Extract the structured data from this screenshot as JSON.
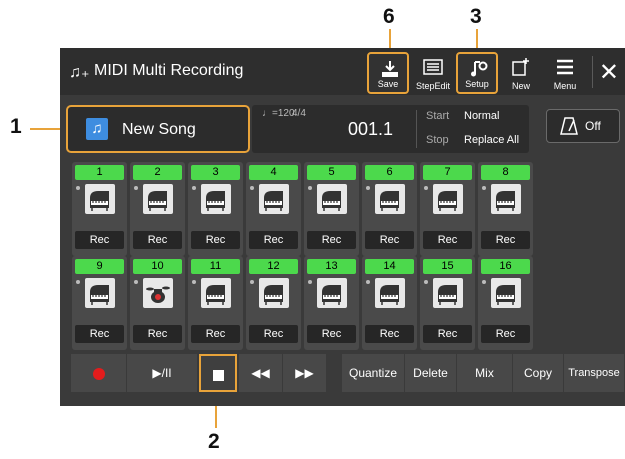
{
  "callouts": {
    "c1": "1",
    "c2": "2",
    "c3": "3",
    "c6": "6"
  },
  "window": {
    "title": "MIDI Multi Recording"
  },
  "toolbar": {
    "save": "Save",
    "stepedit": "StepEdit",
    "setup": "Setup",
    "new": "New",
    "menu": "Menu"
  },
  "song": {
    "name": "New Song",
    "tempo": "♩=120",
    "meter": "4/4",
    "position": "001.1",
    "start_label": "Start",
    "start_value": "Normal",
    "stop_label": "Stop",
    "stop_value": "Replace All"
  },
  "metronome": {
    "label": "Off"
  },
  "tracks_row1": [
    {
      "num": "1",
      "rec": "Rec"
    },
    {
      "num": "2",
      "rec": "Rec"
    },
    {
      "num": "3",
      "rec": "Rec"
    },
    {
      "num": "4",
      "rec": "Rec"
    },
    {
      "num": "5",
      "rec": "Rec"
    },
    {
      "num": "6",
      "rec": "Rec"
    },
    {
      "num": "7",
      "rec": "Rec"
    },
    {
      "num": "8",
      "rec": "Rec"
    }
  ],
  "tracks_row2": [
    {
      "num": "9",
      "rec": "Rec"
    },
    {
      "num": "10",
      "rec": "Rec"
    },
    {
      "num": "11",
      "rec": "Rec"
    },
    {
      "num": "12",
      "rec": "Rec"
    },
    {
      "num": "13",
      "rec": "Rec"
    },
    {
      "num": "14",
      "rec": "Rec"
    },
    {
      "num": "15",
      "rec": "Rec"
    },
    {
      "num": "16",
      "rec": "Rec"
    }
  ],
  "bottom": {
    "play": "▶/II",
    "rew": "◀◀",
    "ff": "▶▶",
    "quantize": "Quantize",
    "delete": "Delete",
    "mix": "Mix",
    "copy": "Copy",
    "transpose": "Transpose"
  },
  "colors": {
    "accent": "#e8a33a",
    "track_green": "#4cd94c",
    "rec_red": "#e31c1c",
    "song_icon": "#3e8de0"
  }
}
